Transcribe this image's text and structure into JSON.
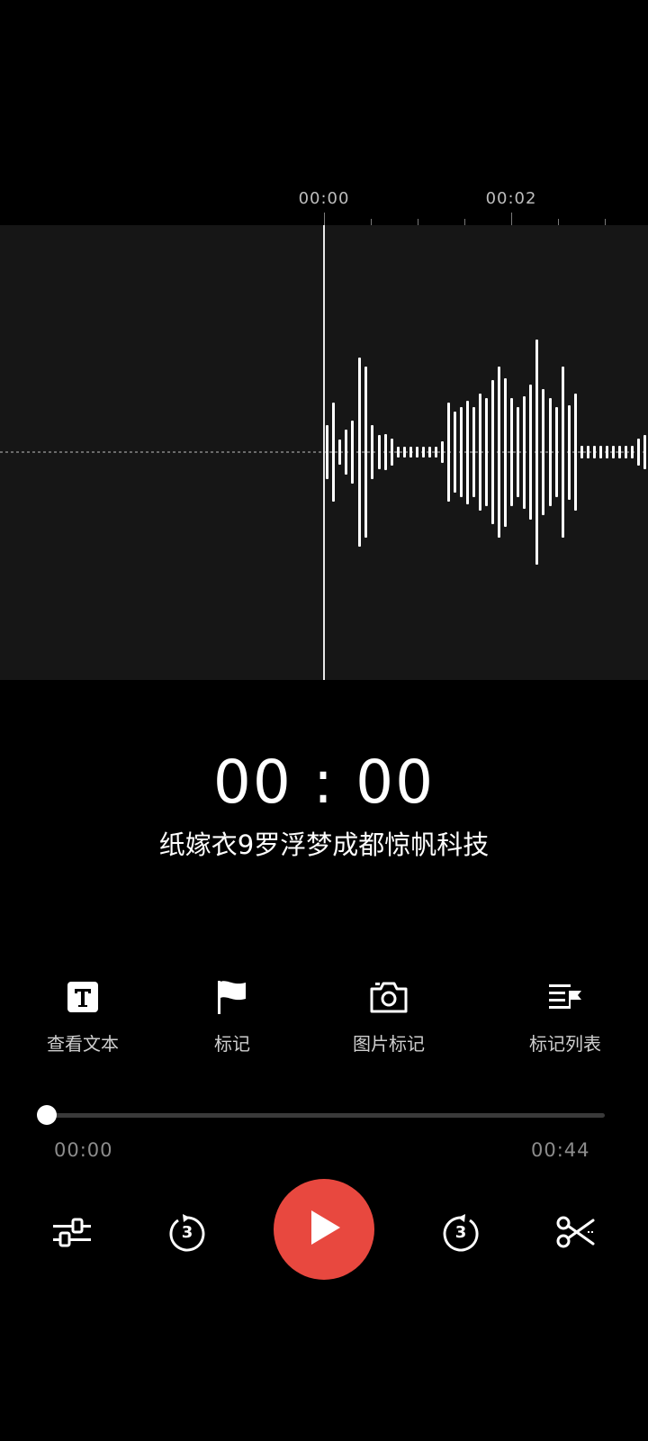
{
  "timeline": {
    "labels": [
      "00:00",
      "00:02"
    ]
  },
  "player": {
    "current_time": "00 : 00",
    "title": "纸嫁衣9罗浮梦成都惊帆科技",
    "position_label": "00:00",
    "duration_label": "00:44",
    "progress": 0.0
  },
  "actions": {
    "view_text": "查看文本",
    "mark": "标记",
    "image_mark": "图片标记",
    "mark_list": "标记列表"
  },
  "controls": {
    "rewind_seconds": "3",
    "forward_seconds": "3"
  },
  "colors": {
    "accent": "#e8483f",
    "background": "#000000",
    "waveform_panel": "#161616"
  },
  "icons": [
    "text-icon",
    "flag-icon",
    "camera-icon",
    "mark-list-icon",
    "settings-sliders-icon",
    "rewind-3s-icon",
    "play-icon",
    "forward-3s-icon",
    "scissors-icon"
  ]
}
